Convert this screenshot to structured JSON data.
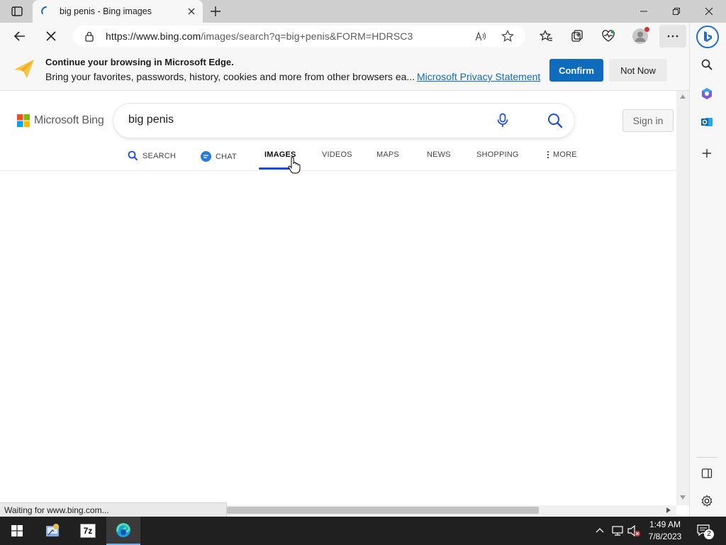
{
  "browser": {
    "tab_title": "big penis - Bing images",
    "url_host": "https://www.bing.com",
    "url_path": "/images/search?q=big+penis&FORM=HDRSC3"
  },
  "infobar": {
    "title": "Continue your browsing in Microsoft Edge.",
    "description": "Bring your favorites, passwords, history, cookies and more from other browsers ea...",
    "link": "Microsoft Privacy Statement",
    "confirm": "Confirm",
    "not_now": "Not Now"
  },
  "bing": {
    "logo_text": "Microsoft Bing",
    "query": "big penis",
    "sign_in": "Sign in",
    "nav": [
      "SEARCH",
      "CHAT",
      "IMAGES",
      "VIDEOS",
      "MAPS",
      "NEWS",
      "SHOPPING",
      "MORE"
    ],
    "active_nav": "IMAGES"
  },
  "status_text": "Waiting for www.bing.com...",
  "taskbar": {
    "time": "1:49 AM",
    "date": "7/8/2023",
    "notification_count": "2"
  },
  "colors": {
    "accent": "#0f6cbd",
    "nav_underline": "#174ae4"
  }
}
